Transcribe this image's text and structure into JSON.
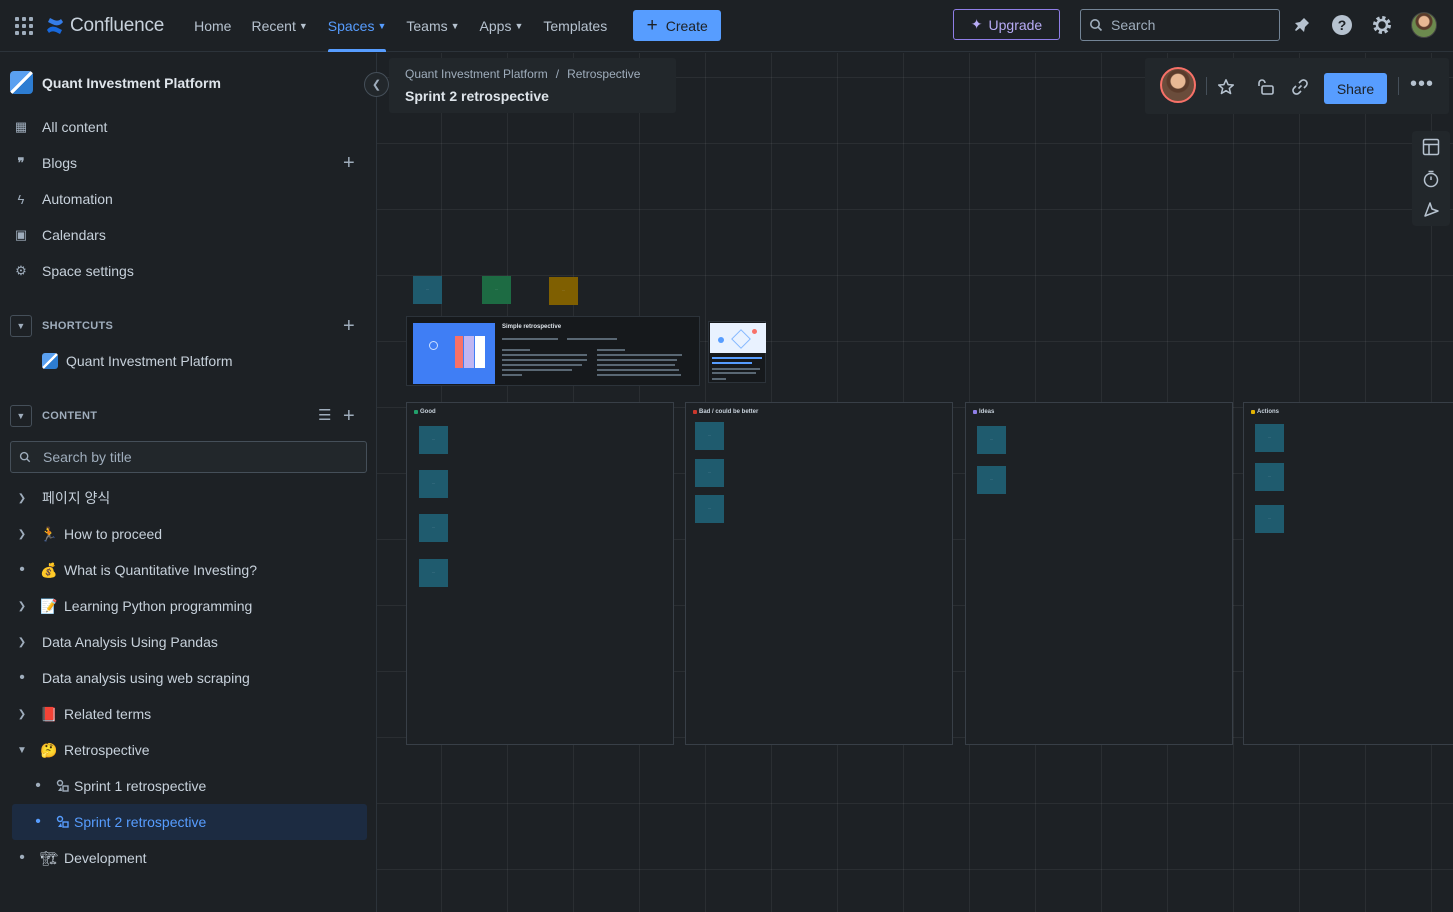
{
  "topnav": {
    "logo": "Confluence",
    "items": [
      {
        "label": "Home"
      },
      {
        "label": "Recent",
        "caret": true
      },
      {
        "label": "Spaces",
        "caret": true,
        "active": true
      },
      {
        "label": "Teams",
        "caret": true
      },
      {
        "label": "Apps",
        "caret": true
      },
      {
        "label": "Templates"
      }
    ],
    "create_label": "Create",
    "upgrade_label": "Upgrade",
    "search_placeholder": "Search",
    "icons": [
      "notifications-icon",
      "help-icon",
      "settings-icon",
      "profile-avatar"
    ]
  },
  "sidebar": {
    "space_name": "Quant Investment Platform",
    "nav": [
      {
        "label": "All content",
        "icon": "grid-icon"
      },
      {
        "label": "Blogs",
        "icon": "quote-icon"
      },
      {
        "label": "Automation",
        "icon": "lightning-icon"
      },
      {
        "label": "Calendars",
        "icon": "calendar-icon"
      },
      {
        "label": "Space settings",
        "icon": "gear-icon"
      }
    ],
    "shortcuts_heading": "SHORTCUTS",
    "shortcut_item": "Quant Investment Platform",
    "content_heading": "CONTENT",
    "content_search_placeholder": "Search by title",
    "tree": [
      {
        "label": "페이지 양식",
        "emoji": "",
        "toggle": "chevron-right"
      },
      {
        "label": "How to proceed",
        "emoji": "🏃",
        "toggle": "chevron-right"
      },
      {
        "label": "What is Quantitative Investing?",
        "emoji": "💰",
        "toggle": "bullet"
      },
      {
        "label": "Learning Python programming",
        "emoji": "📝",
        "toggle": "chevron-right"
      },
      {
        "label": "Data Analysis Using Pandas",
        "emoji": "",
        "toggle": "chevron-right"
      },
      {
        "label": "Data analysis using web scraping",
        "emoji": "",
        "toggle": "bullet"
      },
      {
        "label": "Related terms",
        "emoji": "📕",
        "toggle": "chevron-right"
      },
      {
        "label": "Retrospective",
        "emoji": "🤔",
        "toggle": "chevron-down"
      },
      {
        "label": "Sprint 1 retrospective",
        "child": true
      },
      {
        "label": "Sprint 2 retrospective",
        "child": true,
        "selected": true
      },
      {
        "label": "Development",
        "emoji": "🏗",
        "toggle": "bullet"
      }
    ]
  },
  "page": {
    "breadcrumb": [
      "Quant Investment Platform",
      "Retrospective"
    ],
    "title": "Sprint 2 retrospective",
    "share_label": "Share"
  },
  "whiteboard": {
    "template_title": "Simple retrospective",
    "columns": [
      {
        "title": "Good",
        "dot": "#22a06b"
      },
      {
        "title": "Bad / could be better",
        "dot": "#c9372c"
      },
      {
        "title": "Ideas",
        "dot": "#8f7ee7"
      },
      {
        "title": "Actions",
        "dot": "#e2b203"
      }
    ]
  },
  "colors": {
    "accent": "#579dff",
    "background": "#1d2125",
    "sticky_teal": "#1f5b6e",
    "sticky_green": "#1d6b43",
    "sticky_olive": "#7f5f01"
  }
}
